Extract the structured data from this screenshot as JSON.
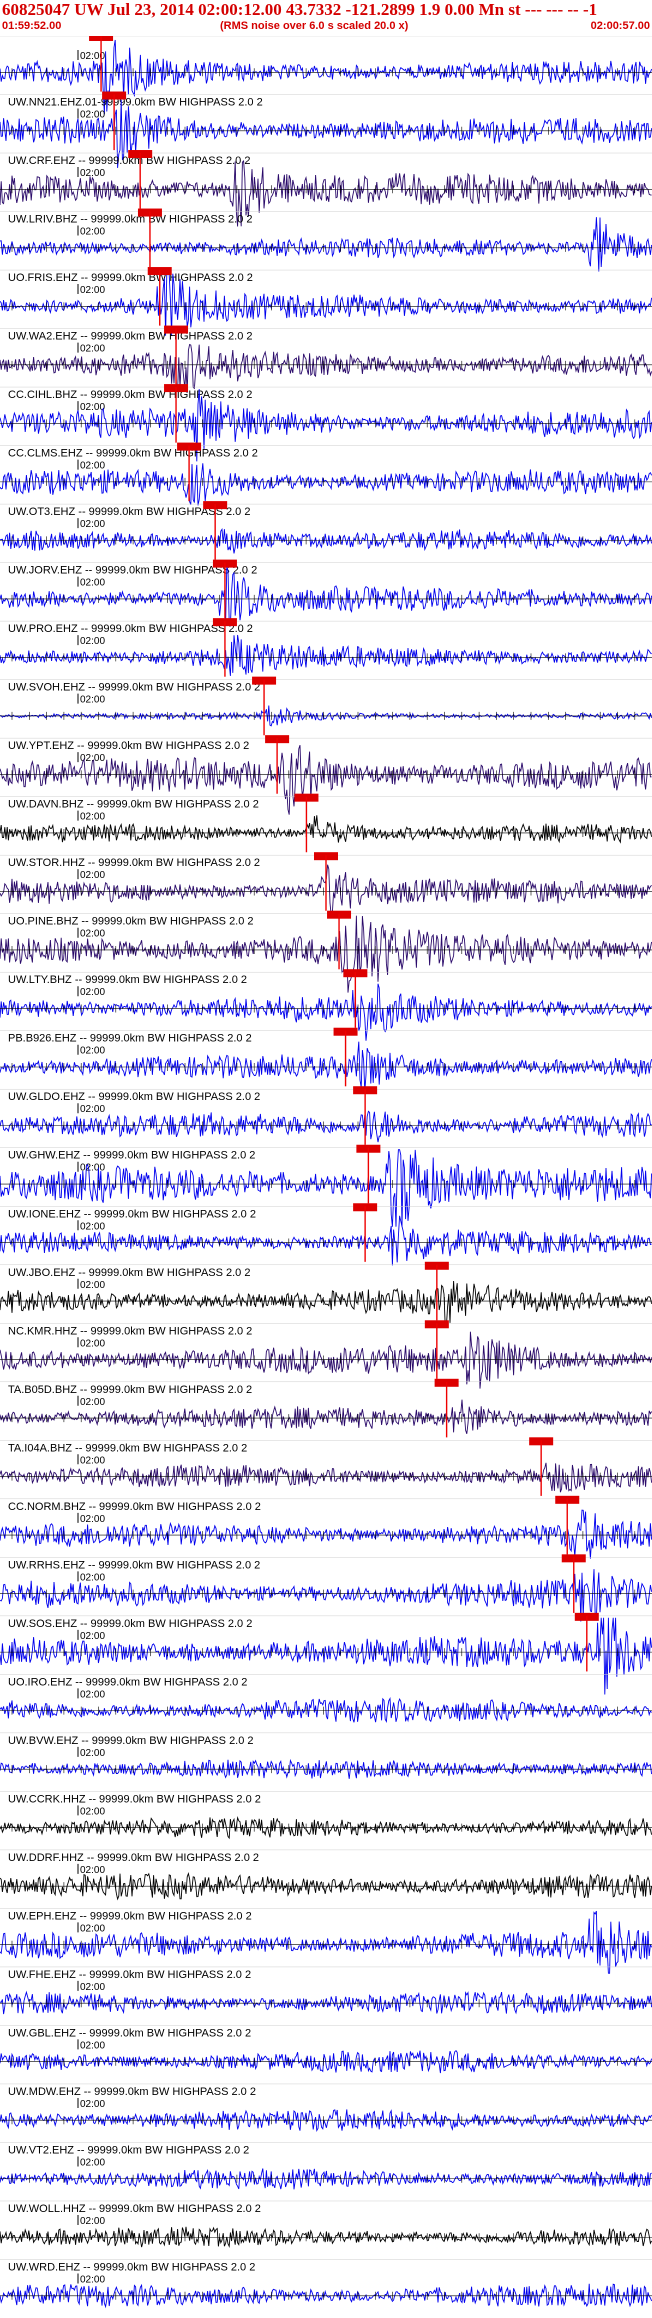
{
  "header": {
    "title": "60825047 UW Jul 23, 2014 02:00:12.00   43.7332 -121.2899  1.9 0.00 Mn st --- --- -- -1",
    "start_time": "01:59:52.00",
    "noise_note": "(RMS noise over 6.0 s scaled 20.0 x)",
    "end_time": "02:00:57.00"
  },
  "time_tick_label": "02:00",
  "colors": {
    "header_text": "#d40000",
    "trace_blue": "#0000ee",
    "trace_purple": "#2a0a6a",
    "trace_black": "#000000",
    "pick_box": "#dd0000",
    "pick_line": "#ee0000",
    "grid": "#000000"
  },
  "stations": [
    {
      "label": "",
      "color": "blue",
      "amp": 0.55,
      "pick": 0.155,
      "burst": 0.16,
      "burst_amp": 1.6
    },
    {
      "label": "UW.NN21.EHZ.01-99999.0km BW  HIGHPASS  2.0  2",
      "color": "blue",
      "amp": 0.6,
      "pick": 0.175,
      "burst": 0.18,
      "burst_amp": 1.2
    },
    {
      "label": "UW.CRF.EHZ -- 99999.0km BW  HIGHPASS  2.0  2",
      "color": "purple",
      "amp": 0.7,
      "pick": 0.215,
      "burst": 0.36,
      "burst_amp": 1.5
    },
    {
      "label": "UW.LRIV.BHZ -- 99999.0km BW  HIGHPASS  2.0  2",
      "color": "blue",
      "amp": 0.45,
      "pick": 0.23,
      "burst": 0.91,
      "burst_amp": 2.0
    },
    {
      "label": "UO.FRIS.EHZ -- 99999.0km BW  HIGHPASS  2.0  2",
      "color": "blue",
      "amp": 0.55,
      "pick": 0.245,
      "burst": 0.25,
      "burst_amp": 1.8
    },
    {
      "label": "UW.WA2.EHZ -- 99999.0km BW  HIGHPASS  2.0  2",
      "color": "purple",
      "amp": 0.6,
      "pick": 0.27,
      "burst": 0.27,
      "burst_amp": 1.0
    },
    {
      "label": "CC.CIHL.BHZ -- 99999.0km BW  HIGHPASS  2.0  2",
      "color": "blue",
      "amp": 0.65,
      "pick": 0.27,
      "burst": 0.3,
      "burst_amp": 1.2
    },
    {
      "label": "CC.CLMS.EHZ -- 99999.0km BW  HIGHPASS  2.0  2",
      "color": "blue",
      "amp": 0.55,
      "pick": 0.29,
      "burst": 0.29,
      "burst_amp": 1.1
    },
    {
      "label": "UW.OT3.EHZ -- 99999.0km BW  HIGHPASS  2.0  2",
      "color": "blue",
      "amp": 0.45,
      "pick": 0.33,
      "burst": 0.34,
      "burst_amp": 0.8
    },
    {
      "label": "UW.JORV.EHZ -- 99999.0km BW  HIGHPASS  2.0  2",
      "color": "blue",
      "amp": 0.55,
      "pick": 0.345,
      "burst": 0.345,
      "burst_amp": 1.4
    },
    {
      "label": "UW.PRO.EHZ -- 99999.0km BW  HIGHPASS  2.0  2",
      "color": "blue",
      "amp": 0.5,
      "pick": 0.345,
      "burst": 0.35,
      "burst_amp": 1.0
    },
    {
      "label": "UW.SVOH.EHZ -- 99999.0km BW  HIGHPASS  2.0  2",
      "color": "blue",
      "amp": 0.15,
      "pick": 0.405,
      "burst": 0.41,
      "burst_amp": 1.8
    },
    {
      "label": "UW.YPT.EHZ -- 99999.0km BW  HIGHPASS  2.0  2",
      "color": "purple",
      "amp": 0.75,
      "pick": 0.425,
      "burst": 0.44,
      "burst_amp": 1.3
    },
    {
      "label": "UW.DAVN.BHZ -- 99999.0km BW  HIGHPASS  2.0  2",
      "color": "black",
      "amp": 0.4,
      "pick": 0.47,
      "burst": 0.48,
      "burst_amp": 1.1
    },
    {
      "label": "UW.STOR.HHZ -- 99999.0km BW  HIGHPASS  2.0  2",
      "color": "purple",
      "amp": 0.55,
      "pick": 0.5,
      "burst": 0.5,
      "burst_amp": 1.2
    },
    {
      "label": "UO.PINE.BHZ -- 99999.0km BW  HIGHPASS  2.0  2",
      "color": "purple",
      "amp": 0.75,
      "pick": 0.52,
      "burst": 0.53,
      "burst_amp": 2.0
    },
    {
      "label": "UW.LTY.BHZ -- 99999.0km BW  HIGHPASS  2.0  2",
      "color": "blue",
      "amp": 0.6,
      "pick": 0.545,
      "burst": 0.55,
      "burst_amp": 1.2
    },
    {
      "label": "PB.B926.EHZ -- 99999.0km BW  HIGHPASS  2.0  2",
      "color": "blue",
      "amp": 0.55,
      "pick": 0.53,
      "burst": 0.55,
      "burst_amp": 1.0
    },
    {
      "label": "UW.GLDO.EHZ -- 99999.0km BW  HIGHPASS  2.0  2",
      "color": "blue",
      "amp": 0.55,
      "pick": 0.56,
      "burst": 0.56,
      "burst_amp": 0.9
    },
    {
      "label": "UW.GHW.EHZ -- 99999.0km BW  HIGHPASS  2.0  2",
      "color": "blue",
      "amp": 0.8,
      "pick": 0.565,
      "burst": 0.6,
      "burst_amp": 2.2
    },
    {
      "label": "UW.IONE.EHZ -- 99999.0km BW  HIGHPASS  2.0  2",
      "color": "blue",
      "amp": 0.5,
      "pick": 0.56,
      "burst": 0.6,
      "burst_amp": 1.4
    },
    {
      "label": "UW.JBO.EHZ -- 99999.0km BW  HIGHPASS  2.0  2",
      "color": "black",
      "amp": 0.55,
      "pick": 0.67,
      "burst": 0.68,
      "burst_amp": 0.9
    },
    {
      "label": "NC.KMR.HHZ -- 99999.0km BW  HIGHPASS  2.0  2",
      "color": "purple",
      "amp": 0.65,
      "pick": 0.67,
      "burst": 0.72,
      "burst_amp": 1.4
    },
    {
      "label": "TA.B05D.BHZ -- 99999.0km BW  HIGHPASS  2.0  2",
      "color": "purple",
      "amp": 0.5,
      "pick": 0.685,
      "burst": 0.7,
      "burst_amp": 1.0
    },
    {
      "label": "TA.I04A.BHZ -- 99999.0km BW  HIGHPASS  2.0  2",
      "color": "purple",
      "amp": 0.5,
      "pick": 0.83,
      "burst": 0.84,
      "burst_amp": 0.8
    },
    {
      "label": "CC.NORM.BHZ -- 99999.0km BW  HIGHPASS  2.0  2",
      "color": "blue",
      "amp": 0.55,
      "pick": 0.87,
      "burst": 0.88,
      "burst_amp": 1.1
    },
    {
      "label": "UW.RRHS.EHZ -- 99999.0km BW  HIGHPASS  2.0  2",
      "color": "blue",
      "amp": 0.6,
      "pick": 0.88,
      "burst": 0.89,
      "burst_amp": 1.0
    },
    {
      "label": "UW.SOS.EHZ -- 99999.0km BW  HIGHPASS  2.0  2",
      "color": "blue",
      "amp": 0.7,
      "pick": 0.9,
      "burst": 0.92,
      "burst_amp": 1.9
    },
    {
      "label": "UO.IRO.EHZ -- 99999.0km BW  HIGHPASS  2.0  2",
      "color": "blue",
      "amp": 0.55,
      "pick": null,
      "burst": null,
      "burst_amp": 0
    },
    {
      "label": "UW.BVW.EHZ -- 99999.0km BW  HIGHPASS  2.0  2",
      "color": "blue",
      "amp": 0.45,
      "pick": null,
      "burst": null,
      "burst_amp": 0
    },
    {
      "label": "UW.CCRK.HHZ -- 99999.0km BW  HIGHPASS  2.0  2",
      "color": "black",
      "amp": 0.45,
      "pick": null,
      "burst": null,
      "burst_amp": 0
    },
    {
      "label": "UW.DDRF.HHZ -- 99999.0km BW  HIGHPASS  2.0  2",
      "color": "black",
      "amp": 0.55,
      "pick": null,
      "burst": null,
      "burst_amp": 0
    },
    {
      "label": "UW.EPH.EHZ -- 99999.0km BW  HIGHPASS  2.0  2",
      "color": "blue",
      "amp": 0.6,
      "pick": null,
      "burst": 0.91,
      "burst_amp": 1.6
    },
    {
      "label": "UW.FHE.EHZ -- 99999.0km BW  HIGHPASS  2.0  2",
      "color": "blue",
      "amp": 0.5,
      "pick": null,
      "burst": null,
      "burst_amp": 0
    },
    {
      "label": "UW.GBL.EHZ -- 99999.0km BW  HIGHPASS  2.0  2",
      "color": "blue",
      "amp": 0.5,
      "pick": null,
      "burst": null,
      "burst_amp": 0
    },
    {
      "label": "UW.MDW.EHZ -- 99999.0km BW  HIGHPASS  2.0  2",
      "color": "blue",
      "amp": 0.5,
      "pick": null,
      "burst": null,
      "burst_amp": 0
    },
    {
      "label": "UW.VT2.EHZ -- 99999.0km BW  HIGHPASS  2.0  2",
      "color": "blue",
      "amp": 0.45,
      "pick": null,
      "burst": null,
      "burst_amp": 0
    },
    {
      "label": "UW.WOLL.HHZ -- 99999.0km BW  HIGHPASS  2.0  2",
      "color": "black",
      "amp": 0.45,
      "pick": null,
      "burst": null,
      "burst_amp": 0
    },
    {
      "label": "UW.WRD.EHZ -- 99999.0km BW  HIGHPASS  2.0  2",
      "color": "blue",
      "amp": 0.5,
      "pick": null,
      "burst": null,
      "burst_amp": 0
    }
  ]
}
